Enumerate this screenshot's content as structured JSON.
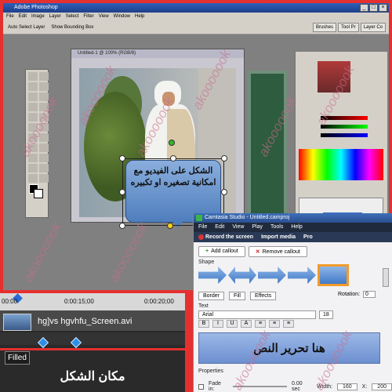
{
  "photoshop": {
    "title": "Adobe Photoshop",
    "menu": [
      "File",
      "Edit",
      "Image",
      "Layer",
      "Select",
      "Filter",
      "View",
      "Window",
      "Help"
    ],
    "options": [
      "Auto Select Layer",
      "Show Bounding Box"
    ],
    "right_tabs": [
      "Brushes",
      "Tool Pr",
      "Layer Co"
    ],
    "doc_title": "Untitled-1 @ 100% (RGB/8)",
    "callout_text": "الشكل على الفيديو مع امكانية تصغيره او تكبيره"
  },
  "watermark": "akooooook",
  "timeline": {
    "time_start": "00:00",
    "time_mid": "0:00:15;00",
    "time_end": "0:00:20;00",
    "clip_name": "hg]vs hgvhfu_Screen.avi",
    "filled_label": "Filled",
    "bottom_label": "مكان الشكل"
  },
  "camtasia": {
    "title": "Camtasia Studio - Untitled.camproj",
    "menu": [
      "File",
      "Edit",
      "View",
      "Play",
      "Tools",
      "Help"
    ],
    "toolbar": {
      "record": "Record the screen",
      "import": "Import media",
      "produce": "Pro"
    },
    "add_callout": "Add callout",
    "remove_callout": "Remove callout",
    "shape_label": "Shape",
    "border_label": "Border",
    "fill_label": "Fill",
    "effects_label": "Effects",
    "rotation_label": "Rotation:",
    "rotation_value": "0",
    "text_label": "Text",
    "font": "Arial",
    "font_size": "18",
    "editor_text": "هنا تحرير النص",
    "properties_label": "Properties",
    "fade_in_label": "Fade in:",
    "fade_in_value": "0.00 sec",
    "width_label": "Width:",
    "width_value": "160",
    "x_label": "X:",
    "x_value": "200"
  }
}
